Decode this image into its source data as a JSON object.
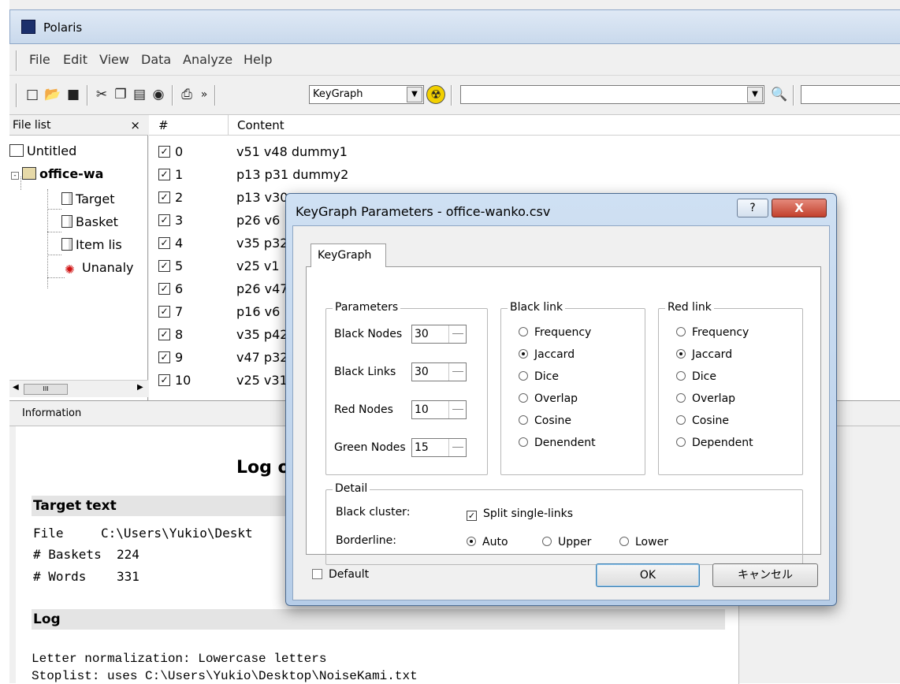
{
  "window": {
    "title": "Polaris"
  },
  "menu": [
    "File",
    "Edit",
    "View",
    "Data",
    "Analyze",
    "Help"
  ],
  "toolbar": {
    "analysis_combo": "KeyGraph",
    "overflow": "»",
    "search_combo": ""
  },
  "file_list": {
    "header": "File list",
    "close": "×",
    "items": [
      "Untitled",
      "office-wa",
      "Target",
      "Basket",
      "Item lis",
      "Unanaly"
    ],
    "scroll_thumb": "III"
  },
  "content_list": {
    "col_index": "#",
    "col_content": "Content",
    "rows": [
      {
        "index": "0",
        "content": "v51 v48 dummy1"
      },
      {
        "index": "1",
        "content": "p13 p31 dummy2"
      },
      {
        "index": "2",
        "content": "p13 v30"
      },
      {
        "index": "3",
        "content": "p26 v6"
      },
      {
        "index": "4",
        "content": "v35 p32"
      },
      {
        "index": "5",
        "content": "v25 v1"
      },
      {
        "index": "6",
        "content": "p26 v47"
      },
      {
        "index": "7",
        "content": "p16 v6"
      },
      {
        "index": "8",
        "content": "v35 p42"
      },
      {
        "index": "9",
        "content": "v47 p32"
      },
      {
        "index": "10",
        "content": "v25 v31"
      }
    ]
  },
  "info": {
    "header": "Information",
    "title": "Log o",
    "target_text": "Target text",
    "file_label": "File",
    "file_value": "C:\\Users\\Yukio\\Deskt",
    "baskets_label": "# Baskets",
    "baskets_value": "224",
    "words_label": "# Words",
    "words_value": "331",
    "log_header": "Log",
    "log_line1": "Letter normalization: Lowercase letters",
    "log_line2": "Stoplist: uses C:\\Users\\Yukio\\Desktop\\NoiseKami.txt"
  },
  "dialog": {
    "title": "KeyGraph Parameters - office-wanko.csv",
    "help": "?",
    "close": "X",
    "tab": "KeyGraph",
    "parameters": {
      "legend": "Parameters",
      "black_nodes_label": "Black Nodes",
      "black_nodes": "30",
      "black_links_label": "Black Links",
      "black_links": "30",
      "red_nodes_label": "Red Nodes",
      "red_nodes": "10",
      "green_nodes_label": "Green Nodes",
      "green_nodes": "15"
    },
    "black_link": {
      "legend": "Black link",
      "options": [
        "Frequency",
        "Jaccard",
        "Dice",
        "Overlap",
        "Cosine",
        "Denendent"
      ],
      "selected": "Jaccard"
    },
    "red_link": {
      "legend": "Red link",
      "options": [
        "Frequency",
        "Jaccard",
        "Dice",
        "Overlap",
        "Cosine",
        "Dependent"
      ],
      "selected": "Jaccard"
    },
    "detail": {
      "legend": "Detail",
      "black_cluster_label": "Black cluster:",
      "split_single_links": "Split single-links",
      "split_checked": true,
      "borderline_label": "Borderline:",
      "borderline_options": [
        "Auto",
        "Upper",
        "Lower"
      ],
      "borderline_selected": "Auto"
    },
    "default_label": "Default",
    "ok": "OK",
    "cancel": "キャンセル"
  },
  "colors": {
    "titlebar": "#c9d9ec",
    "close_button": "#c2402c",
    "app_icon": "#1b2f6b"
  }
}
